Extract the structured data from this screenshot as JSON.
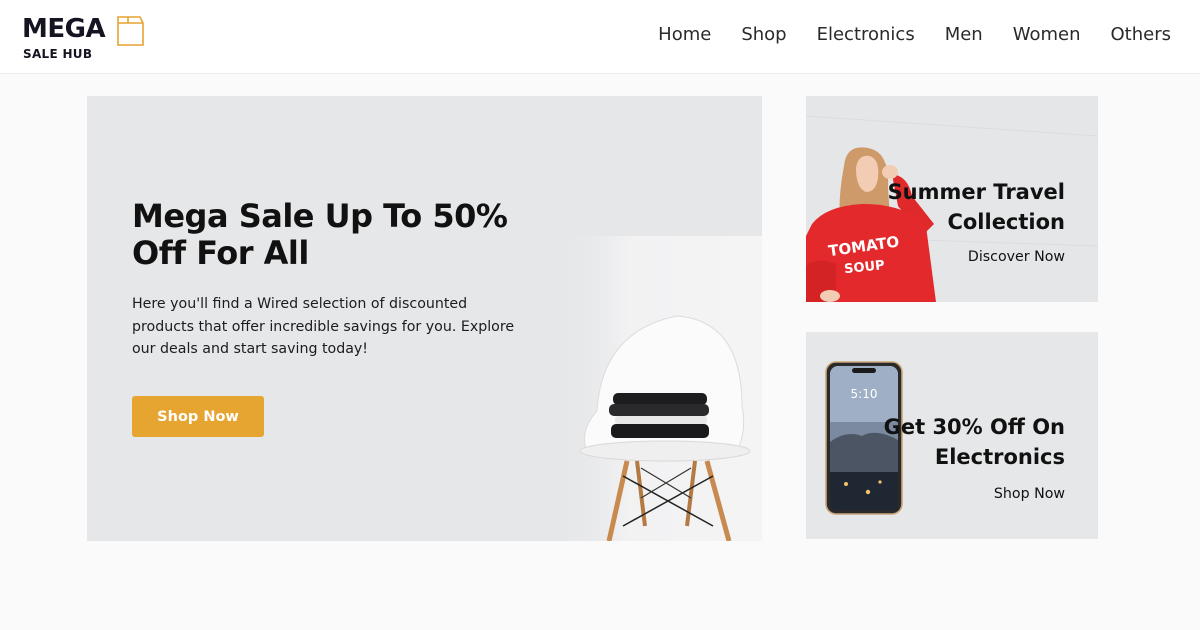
{
  "brand": {
    "name": "MEGA",
    "tagline": "SALE HUB",
    "accent_color": "#e6a431",
    "dark_color": "#151521"
  },
  "nav": {
    "items": [
      {
        "label": "Home"
      },
      {
        "label": "Shop"
      },
      {
        "label": "Electronics"
      },
      {
        "label": "Men"
      },
      {
        "label": "Women"
      },
      {
        "label": "Others"
      }
    ]
  },
  "hero": {
    "title": "Mega Sale Up To 50% Off For All",
    "description": "Here you'll find a Wired selection of discounted products that offer incredible savings for you. Explore our deals and start saving today!",
    "button_label": "Shop Now",
    "image_icon": "chair-with-folded-clothes"
  },
  "promo_cards": [
    {
      "title": "Summer Travel Collection",
      "link_label": "Discover Now",
      "image_icon": "woman-in-red-sweatshirt",
      "image_text": {
        "line1": "TOMATO",
        "line2": "SOUP"
      }
    },
    {
      "title": "Get 30% Off On Electronics",
      "link_label": "Shop Now",
      "image_icon": "smartphone",
      "image_text": {
        "time": "5:10"
      }
    }
  ]
}
